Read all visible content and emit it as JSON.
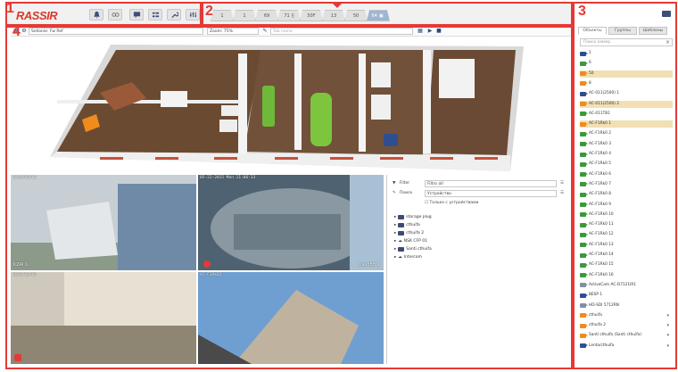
{
  "callouts": [
    "1",
    "2",
    "3",
    "4"
  ],
  "app": {
    "logo": "RASSIR"
  },
  "toolbar": {
    "buttons": [
      {
        "name": "alarm-bell-icon",
        "glyph": "bell"
      },
      {
        "name": "loop-icon",
        "glyph": "loop"
      },
      {
        "name": "chat-icon",
        "glyph": "chat"
      },
      {
        "name": "layout-icon",
        "glyph": "layout"
      },
      {
        "name": "wrench-icon",
        "glyph": "wrench"
      },
      {
        "name": "settings-icon",
        "glyph": "settings"
      }
    ]
  },
  "tabs": [
    "1",
    "1",
    "69",
    "71",
    "50F",
    "13",
    "50",
    "64"
  ],
  "secbar": {
    "layout_label": "Sellanie: Fw Ref",
    "zoom_label": "Zoom: 75%",
    "search_placeholder": "Tab name"
  },
  "cameras": [
    {
      "timestamp": "2019/03/01",
      "label": "KZAI 1"
    },
    {
      "timestamp": "05-22-2015 Mon 11:06:33",
      "label": "plasoBB 1"
    },
    {
      "timestamp": "2019/03/02",
      "label": ""
    },
    {
      "timestamp": "AC-F1Rk02",
      "label": ""
    }
  ],
  "filter": {
    "filter_label": "Filter",
    "filter_value": "Filtro all",
    "search_label": "Поиск",
    "search_value": "Устройство",
    "checkbox_label": "Только с устройствами",
    "tree": [
      "storage plug",
      "cthuifa",
      "cthuifa 2",
      "NSK CFP 01",
      "Santi cthuifa",
      "Intercom"
    ]
  },
  "right_panel": {
    "tabs": [
      "Объекты",
      "Группы",
      "Шаблоны"
    ],
    "search_placeholder": "Поиск камер",
    "devices": [
      {
        "label": "1",
        "color": "blue",
        "hl": false
      },
      {
        "label": "6",
        "color": "green",
        "hl": false
      },
      {
        "label": "50",
        "color": "orange",
        "hl": true
      },
      {
        "label": "8",
        "color": "orange",
        "hl": false
      },
      {
        "label": "AC-011(2500) 1",
        "color": "blue",
        "hl": false
      },
      {
        "label": "AC-011(2500) 2",
        "color": "orange",
        "hl": true
      },
      {
        "label": "AC-011TB1",
        "color": "green",
        "hl": false
      },
      {
        "label": "AC-F1Rk0 1",
        "color": "orange",
        "hl": true
      },
      {
        "label": "AC-F1Rk0 2",
        "color": "green",
        "hl": false
      },
      {
        "label": "AC-F1Rk0 3",
        "color": "green",
        "hl": false
      },
      {
        "label": "AC-F1Rk0 4",
        "color": "green",
        "hl": false
      },
      {
        "label": "AC-F1Rk0 5",
        "color": "green",
        "hl": false
      },
      {
        "label": "AC-F1Rk0 6",
        "color": "green",
        "hl": false
      },
      {
        "label": "AC-F1Rk0 7",
        "color": "green",
        "hl": false
      },
      {
        "label": "AC-F1Rk0 8",
        "color": "green",
        "hl": false
      },
      {
        "label": "AC-F1Rk0 9",
        "color": "green",
        "hl": false
      },
      {
        "label": "AC-F1Rk0 10",
        "color": "green",
        "hl": false
      },
      {
        "label": "AC-F1Rk0 11",
        "color": "green",
        "hl": false
      },
      {
        "label": "AC-F1Rk0 12",
        "color": "green",
        "hl": false
      },
      {
        "label": "AC-F1Rk0 13",
        "color": "green",
        "hl": false
      },
      {
        "label": "AC-F1Rk0 14",
        "color": "green",
        "hl": false
      },
      {
        "label": "AC-F1Rk0 15",
        "color": "green",
        "hl": false
      },
      {
        "label": "AC-F1Rk0 16",
        "color": "green",
        "hl": false
      },
      {
        "label": "ActiveCam AC-D7121IR1",
        "color": "gray",
        "hl": false
      },
      {
        "label": "BESP 1",
        "color": "blue",
        "hl": false
      },
      {
        "label": "HD-SDI 5712RN",
        "color": "gray",
        "hl": false
      },
      {
        "label": "cthuifa",
        "color": "orange",
        "hl": false,
        "chev": true
      },
      {
        "label": "cthuifa 2",
        "color": "orange",
        "hl": false,
        "chev": true
      },
      {
        "label": "Santi cthuifa (Santi cthuifa)",
        "color": "orange",
        "hl": false,
        "chev": true
      },
      {
        "label": "Lenta/cthuifa",
        "color": "blue",
        "hl": false,
        "chev": true
      }
    ]
  }
}
